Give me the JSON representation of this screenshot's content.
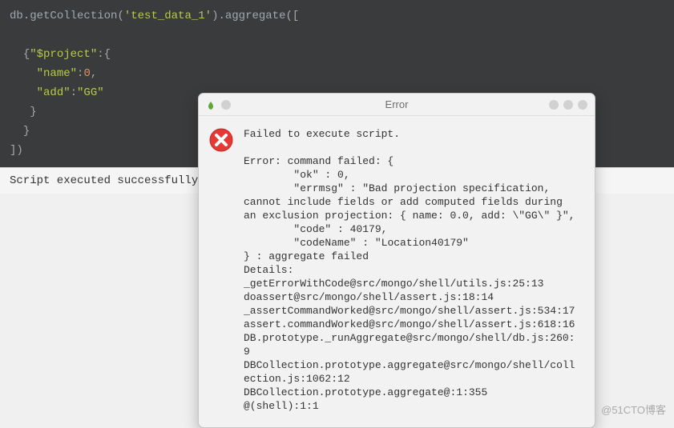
{
  "editor": {
    "lines_raw": "db.getCollection('test_data_1').aggregate([\n\n  {\"$project\":{\n    \"name\":0,\n    \"add\":\"GG\"\n   }\n  }\n])"
  },
  "console": {
    "message": "Script executed successfully,"
  },
  "dialog": {
    "title": "Error",
    "body": "Failed to execute script.\n\nError: command failed: {\n        \"ok\" : 0,\n        \"errmsg\" : \"Bad projection specification, cannot include fields or add computed fields during an exclusion projection: { name: 0.0, add: \\\"GG\\\" }\",\n        \"code\" : 40179,\n        \"codeName\" : \"Location40179\"\n} : aggregate failed\nDetails:\n_getErrorWithCode@src/mongo/shell/utils.js:25:13\ndoassert@src/mongo/shell/assert.js:18:14\n_assertCommandWorked@src/mongo/shell/assert.js:534:17\nassert.commandWorked@src/mongo/shell/assert.js:618:16\nDB.prototype._runAggregate@src/mongo/shell/db.js:260:9\nDBCollection.prototype.aggregate@src/mongo/shell/collection.js:1062:12\nDBCollection.prototype.aggregate@:1:355\n@(shell):1:1"
  },
  "watermark": "@51CTO博客"
}
